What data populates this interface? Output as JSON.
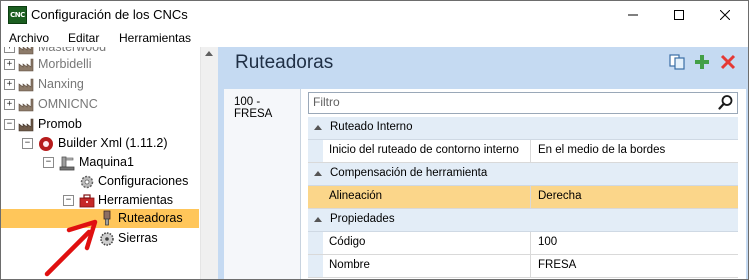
{
  "window": {
    "title": "Configuración de los CNCs",
    "icon_text": "CNC",
    "controls": [
      "minimize-icon",
      "maximize-icon",
      "close-icon"
    ]
  },
  "menu": [
    "Archivo",
    "Editar",
    "Herramientas"
  ],
  "tree": {
    "items": [
      {
        "label": "Masterwood",
        "icon": "factory-icon",
        "expander": "+"
      },
      {
        "label": "Morbidelli",
        "icon": "factory-icon",
        "expander": "+"
      },
      {
        "label": "Nanxing",
        "icon": "factory-icon",
        "expander": "+"
      },
      {
        "label": "OMNICNC",
        "icon": "factory-icon",
        "expander": "+"
      },
      {
        "label": "Promob",
        "icon": "factory-icon",
        "expander": "−"
      },
      {
        "label": "Builder Xml (1.11.2)",
        "icon": "builder-icon",
        "expander": "−"
      },
      {
        "label": "Maquina1",
        "icon": "machine-icon",
        "expander": "−"
      },
      {
        "label": "Configuraciones",
        "icon": "gear-icon"
      },
      {
        "label": "Herramientas",
        "icon": "toolbox-icon",
        "expander": "−"
      },
      {
        "label": "Ruteadoras",
        "icon": "router-bit-icon",
        "selected": true
      },
      {
        "label": "Sierras",
        "icon": "saw-icon"
      }
    ]
  },
  "panel": {
    "title": "Ruteadoras",
    "tab": "100 - FRESA",
    "filter_placeholder": "Filtro",
    "colors": {
      "header_bg": "#c5daf2",
      "selected_bg": "#fbd68a",
      "tree_selected": "#ffc65a"
    },
    "categories": [
      {
        "label": "Ruteado Interno",
        "rows": [
          {
            "name": "Inicio del ruteado de contorno interno",
            "value": "En el medio de la bordes"
          }
        ]
      },
      {
        "label": "Compensación de herramienta",
        "rows": [
          {
            "name": "Alineación",
            "value": "Derecha",
            "selected": true
          }
        ]
      },
      {
        "label": "Propiedades",
        "rows": [
          {
            "name": "Código",
            "value": "100"
          },
          {
            "name": "Nombre",
            "value": "FRESA"
          }
        ]
      }
    ]
  }
}
